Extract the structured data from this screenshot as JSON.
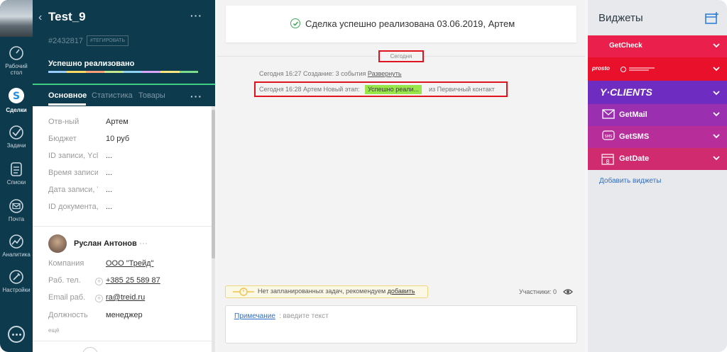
{
  "nav": {
    "items": [
      {
        "label_line1": "Рабочий",
        "label_line2": "стол",
        "icon": "dashboard-icon"
      },
      {
        "label_line1": "Сделки",
        "label_line2": "",
        "icon": "deals-icon"
      },
      {
        "label_line1": "Задачи",
        "label_line2": "",
        "icon": "tasks-icon"
      },
      {
        "label_line1": "Списки",
        "label_line2": "",
        "icon": "lists-icon"
      },
      {
        "label_line1": "Почта",
        "label_line2": "",
        "icon": "mail-icon"
      },
      {
        "label_line1": "Аналитика",
        "label_line2": "",
        "icon": "analytics-icon"
      },
      {
        "label_line1": "Настройки",
        "label_line2": "",
        "icon": "settings-icon"
      }
    ]
  },
  "lead": {
    "title": "Test_9",
    "id": "#2432817",
    "tag": "#ТЕГИРОВАТЬ",
    "stage": "Успешно реализовано",
    "stage_colors": [
      "#99ccff",
      "#ffd966",
      "#ffa07a",
      "#c3e88d",
      "#8fd1f0",
      "#d9a6ff",
      "#ffe680",
      "#7bdc8b"
    ],
    "tabs": [
      "Основное",
      "Статистика",
      "Товары"
    ],
    "fields": [
      {
        "label": "Отв-ный",
        "value": "Артем"
      },
      {
        "label": "Бюджет",
        "value": "10 руб"
      },
      {
        "label": "ID записи, Ycli",
        "value": "..."
      },
      {
        "label": "Время записи, ",
        "value": "..."
      },
      {
        "label": "Дата записи, Y",
        "value": "..."
      },
      {
        "label": "ID документа, ",
        "value": "..."
      }
    ],
    "contact": {
      "name": "Руслан Антонов",
      "fields": [
        {
          "label": "Компания",
          "value": "ООО \"Трейд\""
        },
        {
          "label": "Раб. тел.",
          "value": "+385 25 589 87"
        },
        {
          "label": "Email раб.",
          "value": "ra@treid.ru"
        },
        {
          "label": "Должность",
          "value": "менеджер"
        }
      ],
      "more": "ещё"
    }
  },
  "feed": {
    "banner": "Сделка успешно реализована 03.06.2019, Артем",
    "today": "Сегодня",
    "event1": {
      "prefix": "Сегодня 16:27 Создание: 3 события ",
      "link": "Развернуть"
    },
    "event2": {
      "prefix": "Сегодня 16:28 Артем  Новый этап:",
      "stage": "Успешно реали...",
      "suffix": "из Первичный контакт"
    },
    "task_prefix": "Нет запланированных задач, рекомендуем ",
    "task_link": "добавить",
    "participants": "Участники: 0",
    "note_link": "Примечание",
    "note_placeholder": ": введите текст"
  },
  "widgets": {
    "title": "Виджеты",
    "items": [
      {
        "name": "GetCheck",
        "color": "#ea1f4c"
      },
      {
        "name": "prosto",
        "color": "#e8102a"
      },
      {
        "name": "Y·CLIENTS",
        "color": "#6f2cc0"
      },
      {
        "name": "GetMail",
        "color": "#9a2fb0"
      },
      {
        "name": "GetSMS",
        "color": "#b72e9a"
      },
      {
        "name": "GetDate",
        "color": "#d12b6f"
      }
    ],
    "add_link": "Добавить виджеты"
  }
}
